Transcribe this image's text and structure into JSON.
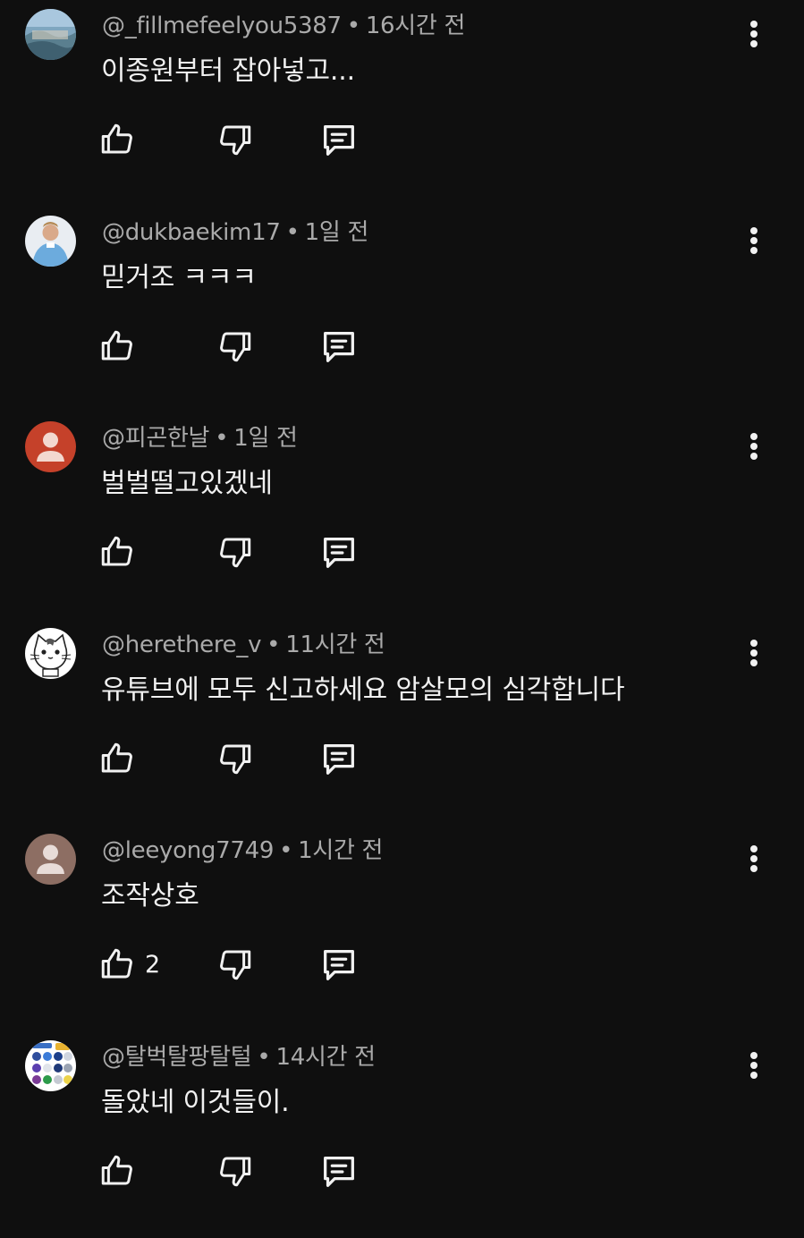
{
  "comments": [
    {
      "author": "@_fillmefeelyou5387",
      "time": "16시간 전",
      "text": "이종원부터 잡아넣고...",
      "likes": "",
      "avatar": "landscape-photo"
    },
    {
      "author": "@dukbaekim17",
      "time": "1일 전",
      "text": "믿거조 ㅋㅋㅋ",
      "likes": "",
      "avatar": "soccer-player-photo"
    },
    {
      "author": "@피곤한날",
      "time": "1일 전",
      "text": "벌벌떨고있겠네",
      "likes": "",
      "avatar": "default-user-red"
    },
    {
      "author": "@herethere_v",
      "time": "11시간 전",
      "text": "유튜브에 모두 신고하세요 암살모의 심각합니다",
      "likes": "",
      "avatar": "cat-drawing"
    },
    {
      "author": "@leeyong7749",
      "time": "1시간 전",
      "text": "조작상호",
      "likes": "2",
      "avatar": "default-user-brown"
    },
    {
      "author": "@탈벅탈팡탈털",
      "time": "14시간 전",
      "text": "돌았네 이것들이.",
      "likes": "",
      "avatar": "logo-collage"
    }
  ],
  "separator": "•",
  "icons": {
    "like": "thumbs-up-icon",
    "dislike": "thumbs-down-icon",
    "reply": "reply-comment-icon",
    "more": "more-vertical-icon"
  },
  "colors": {
    "background": "#0f0f0f",
    "text": "#f1f1f1",
    "meta": "#aaaaaa",
    "avatar_red": "#c5412a",
    "avatar_brown": "#8d6e63"
  }
}
